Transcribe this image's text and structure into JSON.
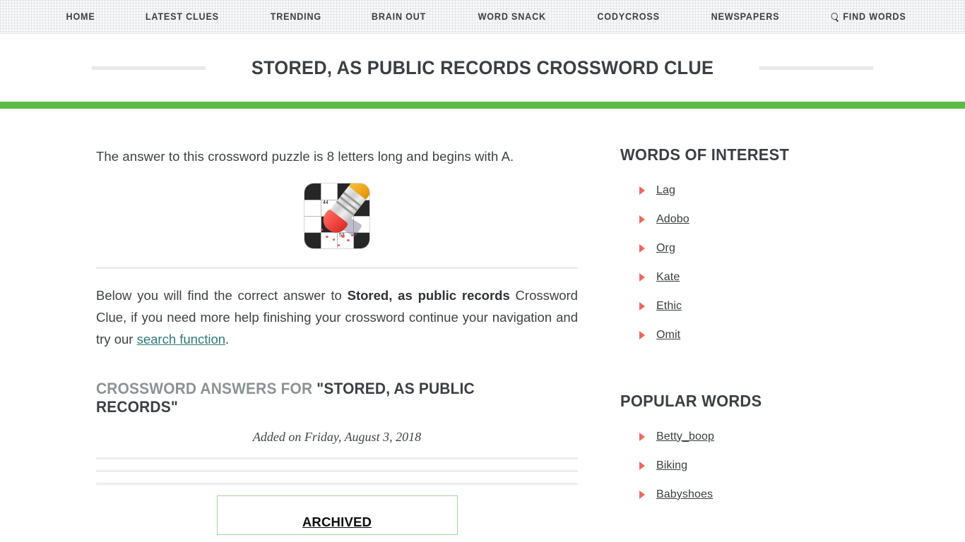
{
  "nav": {
    "items": [
      {
        "label": "HOME",
        "icon": null
      },
      {
        "label": "LATEST CLUES",
        "icon": null
      },
      {
        "label": "TRENDING",
        "icon": null
      },
      {
        "label": "BRAIN OUT",
        "icon": null
      },
      {
        "label": "WORD SNACK",
        "icon": null
      },
      {
        "label": "CODYCROSS",
        "icon": null
      },
      {
        "label": "NEWSPAPERS",
        "icon": null
      },
      {
        "label": "FIND WORDS",
        "icon": "search-icon"
      }
    ]
  },
  "header": {
    "title": "STORED, AS PUBLIC RECORDS CROSSWORD CLUE",
    "accent_color": "#59bb46"
  },
  "main": {
    "intro": "The answer to this crossword puzzle is 8 letters long and begins with A.",
    "puzzle_icon": {
      "name": "crossword-pencil-icon",
      "number_1": "44",
      "number_2": "53"
    },
    "body_part1": "Below you will find the correct answer to ",
    "body_clue": "Stored, as public records",
    "body_part2": " Crossword Clue, if you need more help finishing your crossword continue your navigation and try our ",
    "body_link": "search function",
    "body_part3": ".",
    "answers_heading_prefix": "CROSSWORD ANSWERS FOR ",
    "answers_heading_clue": "\"STORED, AS PUBLIC RECORDS\"",
    "added_on": "Added on Friday, August 3, 2018",
    "archived_label": "ARCHIVED"
  },
  "sidebar": {
    "bullet_color": "#f0675e",
    "sections": [
      {
        "heading": "WORDS OF INTEREST",
        "items": [
          {
            "label": "Lag"
          },
          {
            "label": "Adobo"
          },
          {
            "label": "Org"
          },
          {
            "label": "Kate"
          },
          {
            "label": "Ethic"
          },
          {
            "label": "Omit"
          }
        ]
      },
      {
        "heading": "POPULAR WORDS",
        "items": [
          {
            "label": "Betty_boop"
          },
          {
            "label": "Biking"
          },
          {
            "label": "Babyshoes"
          }
        ]
      }
    ]
  }
}
